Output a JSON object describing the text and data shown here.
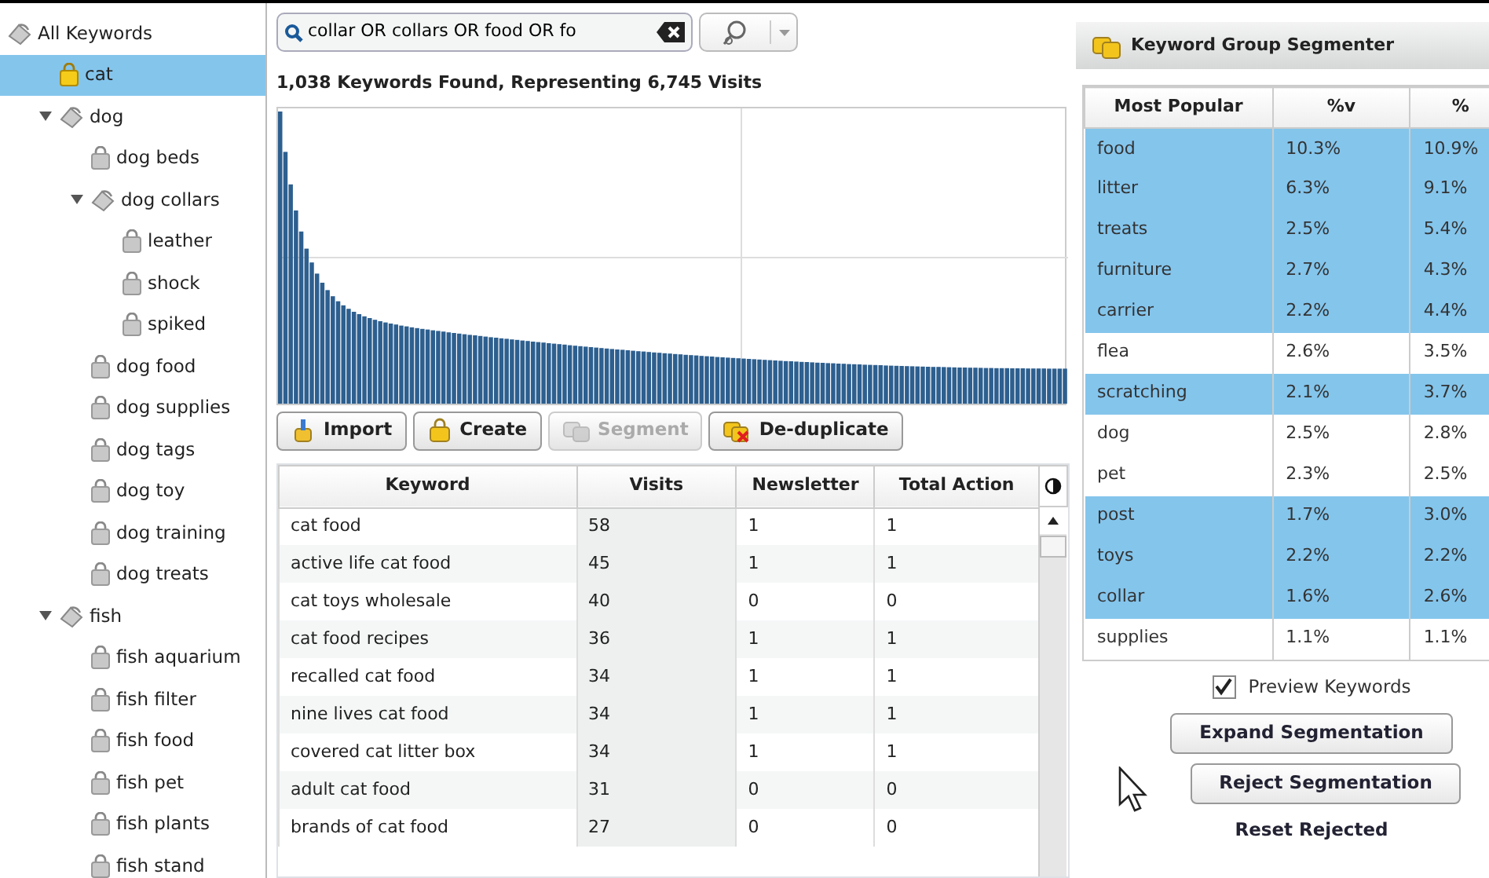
{
  "tree": {
    "label": "All Keywords",
    "children": [
      {
        "label": "cat",
        "selected": true
      },
      {
        "label": "dog",
        "selected": false,
        "expanded": true,
        "children": [
          {
            "label": "dog beds",
            "selected": false
          },
          {
            "label": "dog collars",
            "selected": false,
            "expanded": true,
            "children": [
              {
                "label": "leather",
                "selected": false
              },
              {
                "label": "shock",
                "selected": false
              },
              {
                "label": "spiked",
                "selected": false
              }
            ]
          },
          {
            "label": "dog food",
            "selected": false
          },
          {
            "label": "dog supplies",
            "selected": false
          },
          {
            "label": "dog tags",
            "selected": false
          },
          {
            "label": "dog toy",
            "selected": false
          },
          {
            "label": "dog training",
            "selected": false
          },
          {
            "label": "dog treats",
            "selected": false
          }
        ]
      },
      {
        "label": "fish",
        "selected": false,
        "expanded": true,
        "children": [
          {
            "label": "fish aquarium",
            "selected": false
          },
          {
            "label": "fish filter",
            "selected": false
          },
          {
            "label": "fish food",
            "selected": false
          },
          {
            "label": "fish pet",
            "selected": false
          },
          {
            "label": "fish plants",
            "selected": false
          },
          {
            "label": "fish stand",
            "selected": false
          }
        ]
      }
    ]
  },
  "search": {
    "value": "collar OR collars OR food OR fo"
  },
  "summary": "1,038 Keywords Found, Representing 6,745 Visits",
  "toolbar": [
    {
      "label": "Import",
      "kind": "import",
      "disabled": false
    },
    {
      "label": "Create",
      "kind": "create",
      "disabled": false
    },
    {
      "label": "Segment",
      "kind": "segment",
      "disabled": true
    },
    {
      "label": "De-duplicate",
      "kind": "dedupe",
      "disabled": false
    }
  ],
  "keywords": {
    "columns": [
      "Keyword",
      "Visits",
      "Newsletter",
      "Total Action"
    ],
    "rows": [
      [
        "cat food",
        "58",
        "1",
        "1"
      ],
      [
        "active life cat food",
        "45",
        "1",
        "1"
      ],
      [
        "cat toys wholesale",
        "40",
        "0",
        "0"
      ],
      [
        "cat food recipes",
        "36",
        "1",
        "1"
      ],
      [
        "recalled cat food",
        "34",
        "1",
        "1"
      ],
      [
        "nine lives cat food",
        "34",
        "1",
        "1"
      ],
      [
        "covered cat litter box",
        "34",
        "1",
        "1"
      ],
      [
        "adult cat food",
        "31",
        "0",
        "0"
      ],
      [
        "brands of cat food",
        "27",
        "0",
        "0"
      ]
    ]
  },
  "segmenter": {
    "title": "Keyword Group Segmenter",
    "columns": [
      "Most Popular",
      "%v",
      "%"
    ],
    "rows": [
      {
        "cells": [
          "food",
          "10.3%",
          "10.9%"
        ],
        "selected": true
      },
      {
        "cells": [
          "litter",
          "6.3%",
          "9.1%"
        ],
        "selected": true
      },
      {
        "cells": [
          "treats",
          "2.5%",
          "5.4%"
        ],
        "selected": true
      },
      {
        "cells": [
          "furniture",
          "2.7%",
          "4.3%"
        ],
        "selected": true
      },
      {
        "cells": [
          "carrier",
          "2.2%",
          "4.4%"
        ],
        "selected": true
      },
      {
        "cells": [
          "flea",
          "2.6%",
          "3.5%"
        ],
        "selected": false
      },
      {
        "cells": [
          "scratching",
          "2.1%",
          "3.7%"
        ],
        "selected": true
      },
      {
        "cells": [
          "dog",
          "2.5%",
          "2.8%"
        ],
        "selected": false
      },
      {
        "cells": [
          "pet",
          "2.3%",
          "2.5%"
        ],
        "selected": false
      },
      {
        "cells": [
          "post",
          "1.7%",
          "3.0%"
        ],
        "selected": true
      },
      {
        "cells": [
          "toys",
          "2.2%",
          "2.2%"
        ],
        "selected": true
      },
      {
        "cells": [
          "collar",
          "1.6%",
          "2.6%"
        ],
        "selected": true
      },
      {
        "cells": [
          "supplies",
          "1.1%",
          "1.1%"
        ],
        "selected": false
      }
    ],
    "preview": {
      "label": "Preview Keywords",
      "checked": true
    },
    "buttons": [
      "Expand Segmentation",
      "Reject Segmentation"
    ],
    "link": "Reset Rejected"
  }
}
